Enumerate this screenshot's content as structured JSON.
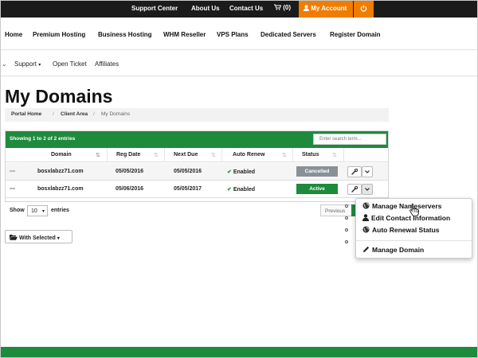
{
  "topbar": {
    "support_center": "Support Center",
    "about_us": "About Us",
    "contact_us": "Contact Us",
    "cart_count": "(0)",
    "my_account": "My Account",
    "accent_color": "#f07c00"
  },
  "main_nav": [
    "Home",
    "Premium Hosting",
    "Business Hosting",
    "WHM Reseller",
    "VPS Plans",
    "Dedicated Servers",
    "Register Domain"
  ],
  "sub_nav": {
    "support": "Support",
    "open_ticket": "Open Ticket",
    "affiliates": "Affiliates"
  },
  "page_title": "My Domains",
  "breadcrumb": [
    "Portal Home",
    "Client Area",
    "My Domains"
  ],
  "table": {
    "info": "Showing 1 to 2 of 2 entries",
    "search_placeholder": "Enter search term...",
    "columns": [
      "Domain",
      "Reg Date",
      "Next Due",
      "Auto Renew",
      "Status"
    ],
    "rows": [
      {
        "domain": "bosxlabzz71.com",
        "reg_date": "05/05/2016",
        "next_due": "05/05/2016",
        "auto_renew": "Enabled",
        "status": "Cancelled"
      },
      {
        "domain": "bosxlabzz71.com",
        "reg_date": "05/06/2016",
        "next_due": "05/05/2017",
        "auto_renew": "Enabled",
        "status": "Active"
      }
    ],
    "header_color": "#1e8a3c"
  },
  "length": {
    "show": "Show",
    "value": "10",
    "entries": "entries"
  },
  "pagination": {
    "previous": "Previous"
  },
  "with_selected": "With Selected",
  "dropdown": {
    "manage_nameservers": "Manage Nameservers",
    "edit_contact": "Edit Contact Information",
    "auto_renewal": "Auto Renewal Status",
    "manage_domain": "Manage Domain"
  }
}
